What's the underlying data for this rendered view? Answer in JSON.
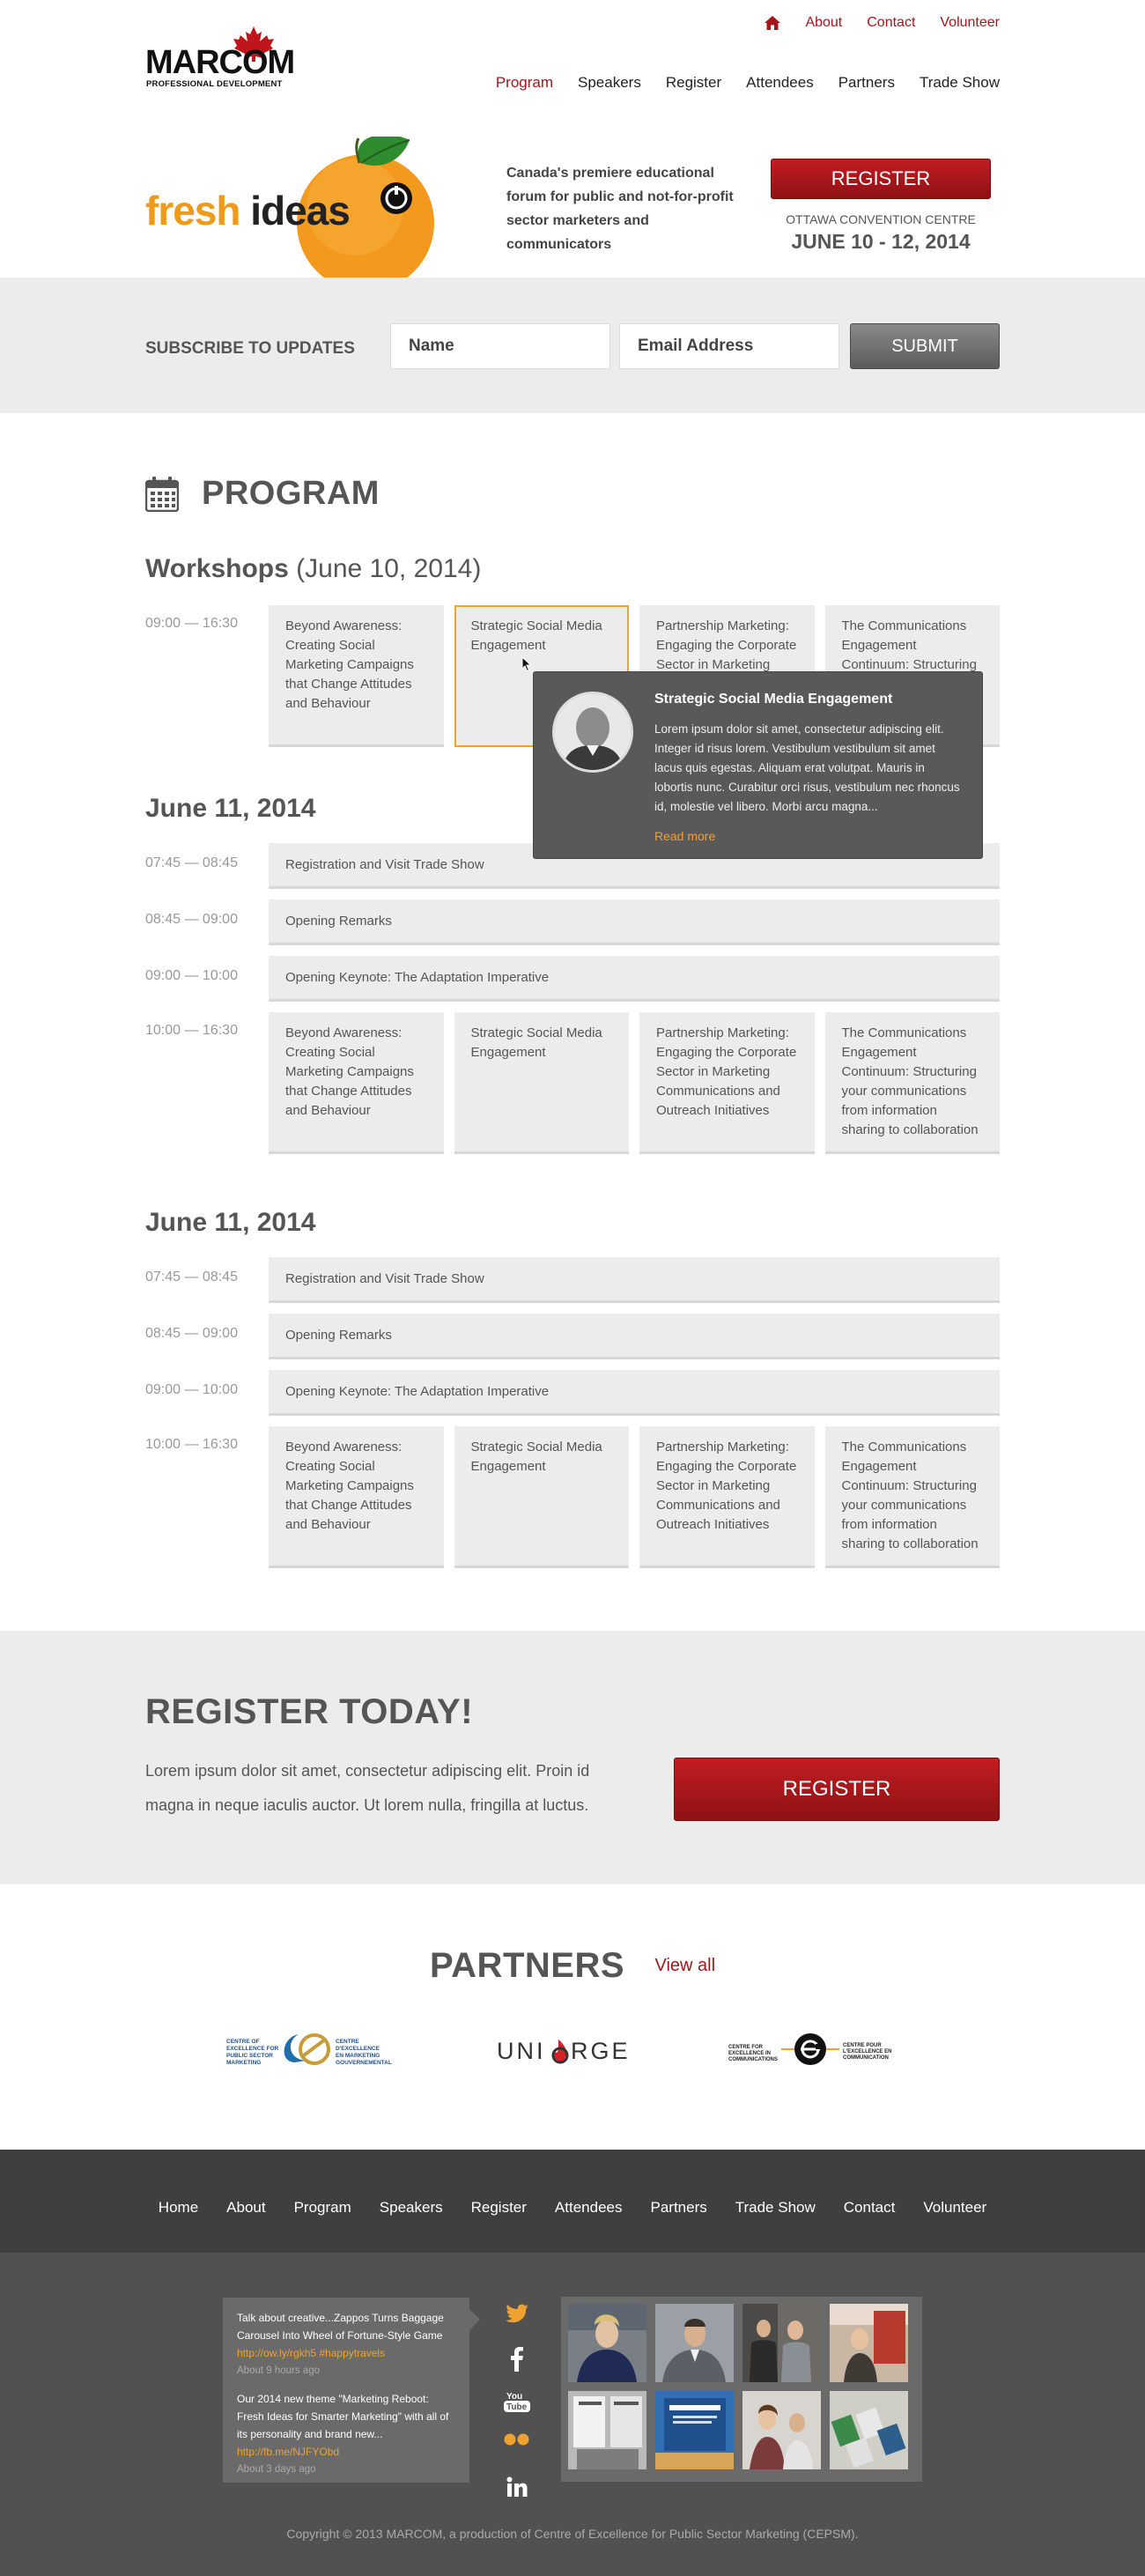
{
  "header": {
    "top_links": [
      "About",
      "Contact",
      "Volunteer"
    ],
    "logo_text": "MARCOM",
    "logo_sub": "PROFESSIONAL DEVELOPMENT",
    "nav": [
      "Program",
      "Speakers",
      "Register",
      "Attendees",
      "Partners",
      "Trade Show"
    ],
    "active_nav": "Program"
  },
  "hero": {
    "fresh": "fresh",
    "ideas": "ideas",
    "tagline": "Canada's premiere educational forum for public and not-for-profit sector marketers and communicators",
    "register_label": "REGISTER",
    "venue": "OTTAWA CONVENTION CENTRE",
    "dates": "JUNE 10 - 12, 2014"
  },
  "subscribe": {
    "label": "SUBSCRIBE TO UPDATES",
    "name_placeholder": "Name",
    "email_placeholder": "Email Address",
    "submit_label": "SUBMIT"
  },
  "program": {
    "title": "PROGRAM",
    "workshops": {
      "title": "Workshops",
      "date": "(June 10, 2014)",
      "time": "09:00 — 16:30",
      "cards": [
        "Beyond Awareness: Creating Social Marketing Campaigns that Change Attitudes and Behaviour",
        "Strategic Social Media Engagement",
        "Partnership Marketing: Engaging the Corporate Sector in Marketing",
        "The Communications Engagement Continuum: Structuring your"
      ]
    },
    "days": [
      {
        "title": "June 11, 2014",
        "slots": [
          {
            "time": "07:45 — 08:45",
            "label": "Registration and Visit Trade Show"
          },
          {
            "time": "08:45 — 09:00",
            "label": "Opening Remarks"
          },
          {
            "time": "09:00 — 10:00",
            "label": "Opening Keynote: The Adaptation Imperative"
          }
        ],
        "session_time": "10:00 — 16:30",
        "cards": [
          "Beyond Awareness: Creating Social Marketing Campaigns that Change Attitudes and Behaviour",
          "Strategic Social Media Engagement",
          "Partnership Marketing: Engaging the Corporate Sector in Marketing Communications and Outreach Initiatives",
          "The Communications Engagement Continuum: Structuring your communications from information sharing to collaboration"
        ]
      },
      {
        "title": "June 11, 2014",
        "slots": [
          {
            "time": "07:45 — 08:45",
            "label": "Registration and Visit Trade Show"
          },
          {
            "time": "08:45 — 09:00",
            "label": "Opening Remarks"
          },
          {
            "time": "09:00 — 10:00",
            "label": "Opening Keynote: The Adaptation Imperative"
          }
        ],
        "session_time": "10:00 — 16:30",
        "cards": [
          "Beyond Awareness: Creating Social Marketing Campaigns that Change Attitudes and Behaviour",
          "Strategic Social Media Engagement",
          "Partnership Marketing: Engaging the Corporate Sector in Marketing Communications and Outreach Initiatives",
          "The Communications Engagement Continuum: Structuring your communications from information sharing to collaboration"
        ]
      }
    ],
    "popup": {
      "title": "Strategic Social Media Engagement",
      "body": "Lorem ipsum dolor sit amet, consectetur adipiscing elit. Integer id risus lorem. Vestibulum vestibulum sit amet lacus quis egestas. Aliquam erat volutpat. Mauris in lobortis nunc. Curabitur orci risus, vestibulum nec rhoncus id, molestie vel libero. Morbi arcu magna...",
      "more": "Read more"
    }
  },
  "register_today": {
    "title": "REGISTER TODAY!",
    "text": "Lorem ipsum dolor sit amet, consectetur adipiscing elit. Proin id magna in neque iaculis auctor. Ut lorem nulla, fringilla at luctus.",
    "button": "REGISTER"
  },
  "partners": {
    "title": "PARTNERS",
    "view_all": "View all",
    "logos": [
      {
        "name": "cepsm-logo",
        "text_left": "CENTRE OF EXCELLENCE FOR PUBLIC SECTOR MARKETING",
        "text_right": "CENTRE D'EXCELLENCE EN MARKETING GOUVERNEMENTAL"
      },
      {
        "name": "uniforge-logo",
        "text_a": "UNI",
        "text_b": "RGE"
      },
      {
        "name": "ceic-logo",
        "text_left": "CENTRE FOR EXCELLENCE IN COMMUNICATIONS",
        "text_right": "CENTRE POUR L'EXCELLENCE EN COMMUNICATION"
      }
    ]
  },
  "footer": {
    "nav": [
      "Home",
      "About",
      "Program",
      "Speakers",
      "Register",
      "Attendees",
      "Partners",
      "Trade Show",
      "Contact",
      "Volunteer"
    ],
    "tweets": [
      {
        "text": "Talk about creative...Zappos Turns Baggage Carousel Into Wheel of Fortune-Style Game",
        "link": "http://ow.ly/rgkh5 #happytravels",
        "ago": "About 9 hours ago"
      },
      {
        "text": "Our 2014 new theme \"Marketing Reboot: Fresh Ideas for Smarter Marketing\" with all of its personality and brand new...",
        "link": "http://fb.me/NJFYObd",
        "ago": "About 3 days ago"
      }
    ],
    "social": [
      "twitter-icon",
      "facebook-icon",
      "youtube-icon",
      "flickr-icon",
      "linkedin-icon"
    ],
    "copyright": "Copyright © 2013 MARCOM, a production of Centre of Excellence for Public Sector Marketing (CEPSM)."
  }
}
